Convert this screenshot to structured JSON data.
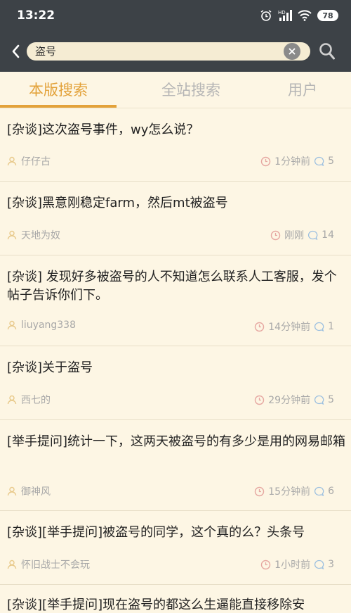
{
  "status": {
    "time": "13:22",
    "battery": "78"
  },
  "search": {
    "query": "盗号"
  },
  "tabs": [
    {
      "label": "本版搜索"
    },
    {
      "label": "全站搜索"
    },
    {
      "label": "用户"
    }
  ],
  "posts": [
    {
      "title": "[杂谈]这次盗号事件，wy怎么说？",
      "author": "仔仔古",
      "time": "1分钟前",
      "replies": "5"
    },
    {
      "title": "[杂谈]黑意刚稳定farm，然后mt被盗号",
      "author": "天地为奴",
      "time": "刚刚",
      "replies": "14"
    },
    {
      "title": "[杂谈] 发现好多被盗号的人不知道怎么联系人工客服，发个帖子告诉你们下。",
      "author": "liuyang338",
      "time": "14分钟前",
      "replies": "1"
    },
    {
      "title": "[杂谈]关于盗号",
      "author": "西七的",
      "time": "29分钟前",
      "replies": "5"
    },
    {
      "title": "[举手提问]统计一下，这两天被盗号的有多少是用的网易邮箱",
      "author": "御神风",
      "time": "15分钟前",
      "replies": "6"
    },
    {
      "title": "[杂谈][举手提问]被盗号的同学，这个真的么？头条号",
      "author": "怀旧战士不会玩",
      "time": "1小时前",
      "replies": "3"
    },
    {
      "title": "[杂谈][举手提问]现在盗号的都这么生逼能直接移除安",
      "author": "",
      "time": "",
      "replies": ""
    }
  ]
}
